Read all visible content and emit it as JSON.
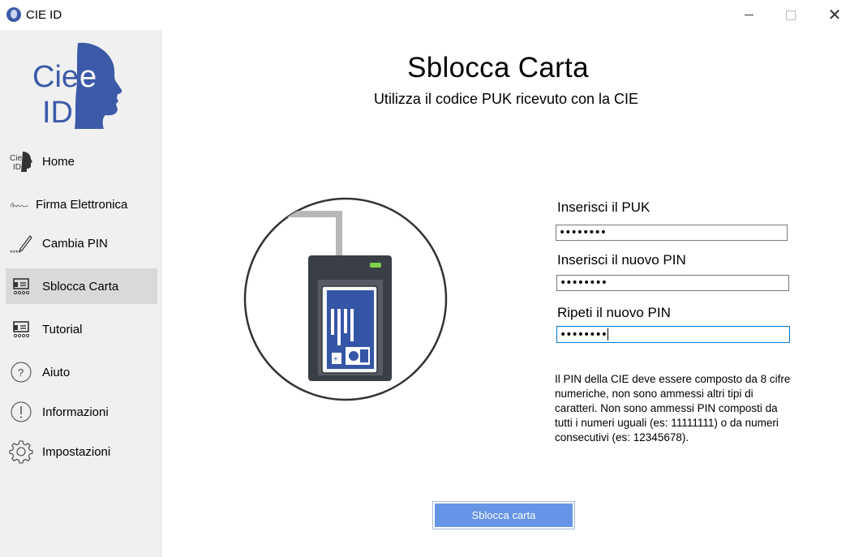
{
  "window": {
    "title": "CIE ID"
  },
  "sidebar": {
    "items": [
      {
        "label": "Home",
        "icon": "cie-id-icon"
      },
      {
        "label": "Firma Elettronica",
        "icon": "signature-icon"
      },
      {
        "label": "Cambia PIN",
        "icon": "pencil-icon"
      },
      {
        "label": "Sblocca Carta",
        "icon": "card-reader-icon",
        "active": true
      },
      {
        "label": "Tutorial",
        "icon": "card-reader-icon"
      },
      {
        "label": "Aiuto",
        "icon": "question-icon"
      },
      {
        "label": "Informazioni",
        "icon": "info-icon"
      },
      {
        "label": "Impostazioni",
        "icon": "gear-icon"
      }
    ]
  },
  "main": {
    "title": "Sblocca Carta",
    "subtitle": "Utilizza il codice PUK ricevuto con la CIE",
    "fields": {
      "puk_label": "Inserisci il PUK",
      "puk_value": "••••••••",
      "new_pin_label": "Inserisci il nuovo PIN",
      "new_pin_value": "••••••••",
      "repeat_pin_label": "Ripeti il nuovo PIN",
      "repeat_pin_value": "••••••••"
    },
    "info": "Il PIN della CIE deve essere composto da 8 cifre numeriche, non sono ammessi altri tipi di caratteri. Non sono ammessi PIN composti da tutti i numeri uguali (es: 11111111) o da numeri consecutivi (es: 12345678).",
    "submit_label": "Sblocca carta"
  },
  "colors": {
    "accent": "#3b5aa8",
    "button": "#6695e6",
    "sidebar_bg": "#f0f0f0",
    "active_item_bg": "#d9d9d9"
  }
}
